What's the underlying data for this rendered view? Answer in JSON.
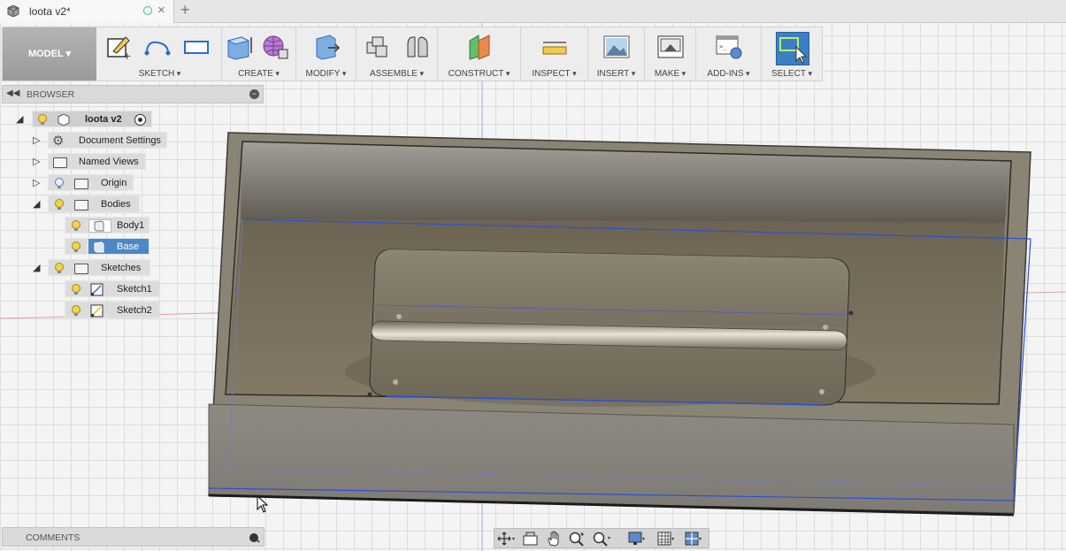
{
  "tab": {
    "title": "loota v2",
    "modified_mark": "*"
  },
  "toolbar": {
    "mode_label": "MODEL",
    "groups": [
      {
        "label": "SKETCH"
      },
      {
        "label": "CREATE"
      },
      {
        "label": "MODIFY"
      },
      {
        "label": "ASSEMBLE"
      },
      {
        "label": "CONSTRUCT"
      },
      {
        "label": "INSPECT"
      },
      {
        "label": "INSERT"
      },
      {
        "label": "MAKE"
      },
      {
        "label": "ADD-INS"
      },
      {
        "label": "SELECT"
      }
    ]
  },
  "browser": {
    "header": "BROWSER",
    "root": "loota v2",
    "items": [
      {
        "label": "Document Settings"
      },
      {
        "label": "Named Views"
      },
      {
        "label": "Origin"
      },
      {
        "label": "Bodies"
      },
      {
        "label": "Body1"
      },
      {
        "label": "Base"
      },
      {
        "label": "Sketches"
      },
      {
        "label": "Sketch1"
      },
      {
        "label": "Sketch2"
      }
    ]
  },
  "comments": {
    "label": "COMMENTS"
  },
  "colors": {
    "accent": "#4a88c8",
    "select_button": "#3b7fc4",
    "model_body": "#8a8474",
    "sketch_line": "#2b4fd8"
  }
}
